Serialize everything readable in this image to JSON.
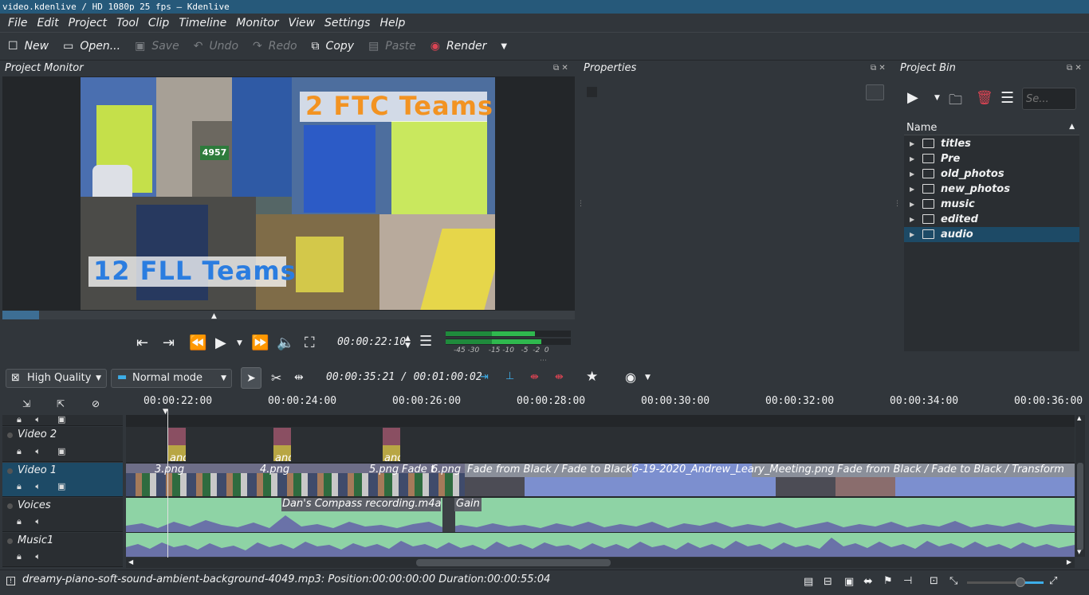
{
  "window": {
    "title": "video.kdenlive / HD 1080p 25 fps — Kdenlive"
  },
  "menu": [
    "File",
    "Edit",
    "Project",
    "Tool",
    "Clip",
    "Timeline",
    "Monitor",
    "View",
    "Settings",
    "Help"
  ],
  "toolbar": {
    "new": "New",
    "open": "Open...",
    "save": "Save",
    "undo": "Undo",
    "redo": "Redo",
    "copy": "Copy",
    "paste": "Paste",
    "render": "Render"
  },
  "project_monitor": {
    "title": "Project Monitor",
    "overlay_ftc": "2 FTC Teams",
    "overlay_fll": "12 FLL Teams",
    "sign_number": "4957",
    "timecode": "00:00:22:10",
    "meter_scale": "-45 -30    -15 -10   -5  -2  0"
  },
  "properties": {
    "title": "Properties"
  },
  "project_bin": {
    "title": "Project Bin",
    "search_placeholder": "Se...",
    "column_name": "Name",
    "folders": [
      "titles",
      "Pre",
      "old_photos",
      "new_photos",
      "music",
      "edited",
      "audio"
    ],
    "selected_folder": "audio"
  },
  "timeline_toolbar": {
    "quality": "High Quality",
    "mode": "Normal mode",
    "position": "00:00:35:21 / 00:01:00:02"
  },
  "ruler": [
    "00:00:22:00",
    "00:00:24:00",
    "00:00:26:00",
    "00:00:28:00",
    "00:00:30:00",
    "00:00:32:00",
    "00:00:34:00",
    "00:00:36:00"
  ],
  "tracks": {
    "video2": "Video 2",
    "video1": "Video 1",
    "voices": "Voices",
    "music1": "Music1"
  },
  "clips": {
    "title_a": "and",
    "v1_a": "3.png",
    "v1_b": "4.png",
    "v1_c": "5.png",
    "v1_d": "Fade t",
    "v1_e": "6.png",
    "v1_f": "Fade from Black / Fade to Black",
    "v1_g": "6-19-2020_Andrew_Leary_Meeting.png",
    "v1_h": "Fade from Black / Fade to Black / Transform",
    "voice": "Dan's Compass recording.m4a",
    "voice_gain": "Gain"
  },
  "status": {
    "message": "dreamy-piano-soft-sound-ambient-background-4049.mp3: Position:00:00:00:00 Duration:00:00:55:04"
  },
  "colors": {
    "selection": "#1d4a66",
    "audio_clip": "#8ed3a5",
    "waveform": "#6a72a8",
    "accent": "#3daee9"
  }
}
